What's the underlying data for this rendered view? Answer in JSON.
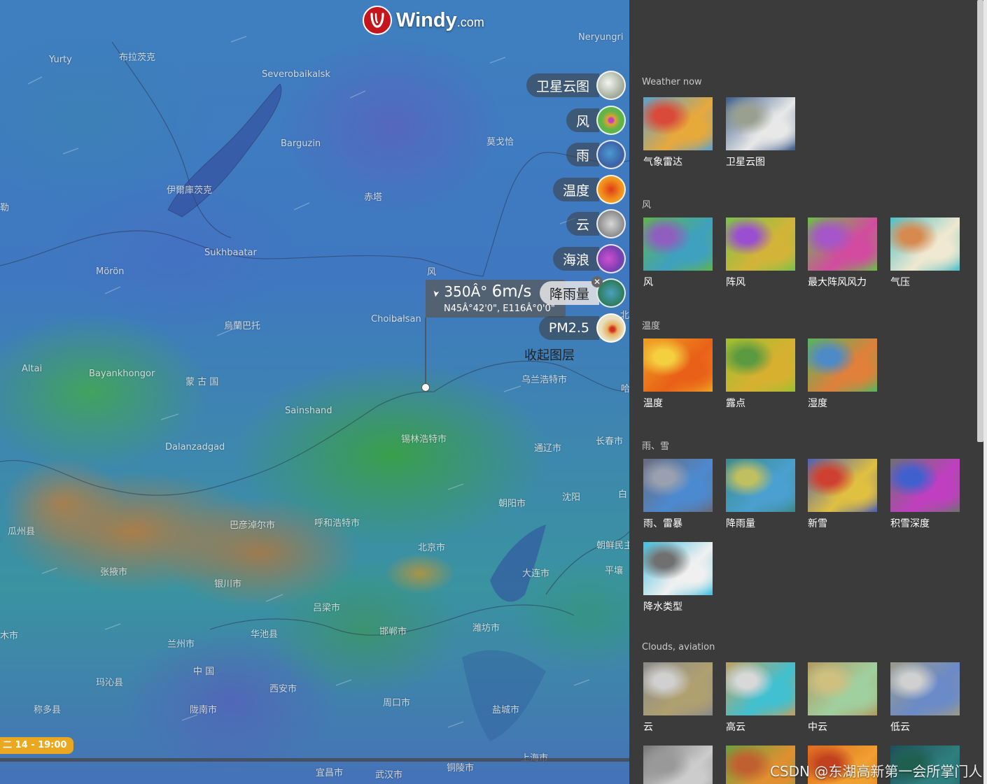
{
  "brand": {
    "name": "Windy",
    "suffix": ".com"
  },
  "map_labels": [
    {
      "text": "Yurty"
    },
    {
      "text": "布拉茨克"
    },
    {
      "text": "Severobaikalsk"
    },
    {
      "text": "Neryungri"
    },
    {
      "text": "Barguzin"
    },
    {
      "text": "莫戈恰"
    },
    {
      "text": "伊爾庫茨克"
    },
    {
      "text": "赤塔"
    },
    {
      "text": "勒"
    },
    {
      "text": "Sukhbaatar"
    },
    {
      "text": "Mörön"
    },
    {
      "text": "风"
    },
    {
      "text": "烏蘭巴托"
    },
    {
      "text": "Choibalsan"
    },
    {
      "text": "Altai"
    },
    {
      "text": "Bayankhongor"
    },
    {
      "text": "蒙 古 国"
    },
    {
      "text": "乌兰浩特市"
    },
    {
      "text": "Sainshand"
    },
    {
      "text": "锡林浩特市"
    },
    {
      "text": "Dalanzadgad"
    },
    {
      "text": "通辽市"
    },
    {
      "text": "长春市"
    },
    {
      "text": "朝阳市"
    },
    {
      "text": "沈阳"
    },
    {
      "text": "瓜州县"
    },
    {
      "text": "巴彦淖尔市"
    },
    {
      "text": "呼和浩特市"
    },
    {
      "text": "北京市"
    },
    {
      "text": "张掖市"
    },
    {
      "text": "朝鲜民主"
    },
    {
      "text": "银川市"
    },
    {
      "text": "大连市"
    },
    {
      "text": "平壤"
    },
    {
      "text": "吕梁市"
    },
    {
      "text": "木市"
    },
    {
      "text": "华池县"
    },
    {
      "text": "邯郸市"
    },
    {
      "text": "潍坊市"
    },
    {
      "text": "兰州市"
    },
    {
      "text": "中 国"
    },
    {
      "text": "玛沁县"
    },
    {
      "text": "西安市"
    },
    {
      "text": "称多县"
    },
    {
      "text": "陇南市"
    },
    {
      "text": "周口市"
    },
    {
      "text": "盐城市"
    },
    {
      "text": "宜昌市"
    },
    {
      "text": "武汉市"
    },
    {
      "text": "铜陵市"
    },
    {
      "text": "上海市"
    },
    {
      "text": "哈"
    },
    {
      "text": "北"
    },
    {
      "text": "白"
    }
  ],
  "layers": [
    {
      "label": "卫星云图",
      "thumb_color": "#d9ddd6"
    },
    {
      "label": "风",
      "thumb_color": "#5fb54a"
    },
    {
      "label": "雨",
      "thumb_color": "#3d79b8"
    },
    {
      "label": "温度",
      "thumb_color": "#f08a1c"
    },
    {
      "label": "云",
      "thumb_color": "#a9a9a9"
    },
    {
      "label": "海浪",
      "thumb_color": "#b54bb8"
    },
    {
      "label": "降雨量",
      "thumb_color": "#3c8a6a"
    },
    {
      "label": "PM2.5",
      "thumb_color": "#e9d9a0"
    }
  ],
  "collapse_label": "收起图层",
  "picker": {
    "arrow": "➤",
    "direction": "350Â°",
    "speed": "6m/s",
    "coords": "N45Â°42'0\", E116Â°0'0\""
  },
  "time_badge": "二 14 - 19:00",
  "panel": {
    "sections": [
      {
        "title": "Weather now",
        "items": [
          {
            "label": "气象雷达",
            "colors": [
              "#5aa2d0",
              "#e8a93b",
              "#d94a3a"
            ]
          },
          {
            "label": "卫星云图",
            "colors": [
              "#3d5d8c",
              "#e8e8e8",
              "#9aa090"
            ]
          }
        ]
      },
      {
        "title": "风",
        "items": [
          {
            "label": "风",
            "colors": [
              "#5fb54a",
              "#3fa0c0",
              "#8f5fc0"
            ]
          },
          {
            "label": "阵风",
            "colors": [
              "#79c24a",
              "#d4b438",
              "#9a4fd0"
            ]
          },
          {
            "label": "最大阵风风力",
            "colors": [
              "#6bbf45",
              "#d24ba0",
              "#a556c8"
            ]
          },
          {
            "label": "气压",
            "colors": [
              "#4ec0c8",
              "#f0e8d0",
              "#d78a50"
            ]
          }
        ]
      },
      {
        "title": "温度",
        "items": [
          {
            "label": "温度",
            "colors": [
              "#f0a020",
              "#e96018",
              "#f4d040"
            ]
          },
          {
            "label": "露点",
            "colors": [
              "#9cc030",
              "#d8b030",
              "#5a9a40"
            ]
          },
          {
            "label": "湿度",
            "colors": [
              "#55b560",
              "#e0803a",
              "#4d8ac8"
            ]
          }
        ]
      },
      {
        "title": "雨、雪",
        "items": [
          {
            "label": "雨、雷暴",
            "colors": [
              "#6a6a7a",
              "#4c8ad0",
              "#9aa0b0"
            ]
          },
          {
            "label": "降雨量",
            "colors": [
              "#3c8a8a",
              "#4aa0d0",
              "#c0c060"
            ]
          },
          {
            "label": "新雪",
            "colors": [
              "#5060b0",
              "#e0c040",
              "#d04030"
            ]
          },
          {
            "label": "积雪深度",
            "colors": [
              "#707070",
              "#c03fc0",
              "#4060d0"
            ]
          },
          {
            "label": "降水类型",
            "colors": [
              "#40c0e0",
              "#f0f0f0",
              "#707070"
            ]
          }
        ]
      },
      {
        "title": "Clouds, aviation",
        "items": [
          {
            "label": "云",
            "colors": [
              "#8a8a8a",
              "#b0a070",
              "#d0d0d0"
            ]
          },
          {
            "label": "高云",
            "colors": [
              "#c0a060",
              "#40c0d0",
              "#d8d8d8"
            ]
          },
          {
            "label": "中云",
            "colors": [
              "#b09a60",
              "#a0d0a0",
              "#d0c080"
            ]
          },
          {
            "label": "低云",
            "colors": [
              "#9a9a88",
              "#6a8ac8",
              "#d0d0d0"
            ]
          },
          {
            "label": "",
            "colors": [
              "#777777",
              "#cccccc",
              "#999999"
            ]
          },
          {
            "label": "",
            "colors": [
              "#6aa040",
              "#e09030",
              "#c06030"
            ]
          },
          {
            "label": "",
            "colors": [
              "#e06a20",
              "#f0a030",
              "#c04020"
            ]
          },
          {
            "label": "",
            "colors": [
              "#1f4f5a",
              "#2f7f7f",
              "#1f5f4f"
            ]
          }
        ]
      }
    ]
  },
  "watermark": "CSDN @东湖高新第一会所掌门人"
}
